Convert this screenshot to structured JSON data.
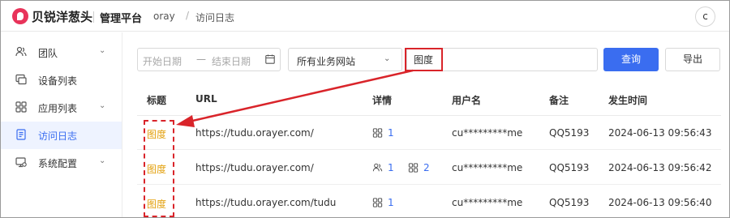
{
  "header": {
    "brand": "贝锐洋葱头",
    "platform": "管理平台",
    "breadcrumb": [
      "oray",
      "访问日志"
    ],
    "avatar_letter": "c"
  },
  "sidebar": {
    "items": [
      {
        "label": "团队",
        "icon": "team-icon",
        "has_caret": true,
        "active": false
      },
      {
        "label": "设备列表",
        "icon": "device-icon",
        "has_caret": false,
        "active": false
      },
      {
        "label": "应用列表",
        "icon": "apps-icon",
        "has_caret": true,
        "active": false
      },
      {
        "label": "访问日志",
        "icon": "log-icon",
        "has_caret": false,
        "active": true
      },
      {
        "label": "系统配置",
        "icon": "settings-icon",
        "has_caret": true,
        "active": false
      }
    ]
  },
  "filters": {
    "start_date_placeholder": "开始日期",
    "dash": "—",
    "end_date_placeholder": "结束日期",
    "site_select": "所有业务网站",
    "search_value": "图度",
    "query_label": "查询",
    "export_label": "导出"
  },
  "table": {
    "headers": {
      "title": "标题",
      "url": "URL",
      "detail": "详情",
      "user": "用户名",
      "note": "备注",
      "time": "发生时间"
    },
    "rows": [
      {
        "title": "图度",
        "url": "https://tudu.orayer.com/",
        "details": [
          {
            "icon": "apps-icon",
            "count": "1"
          }
        ],
        "user": "cu*********me",
        "note": "QQ5193",
        "time": "2024-06-13 09:56:43"
      },
      {
        "title": "图度",
        "url": "https://tudu.orayer.com/",
        "details": [
          {
            "icon": "team-icon",
            "count": "1"
          },
          {
            "icon": "apps-icon",
            "count": "2"
          }
        ],
        "user": "cu*********me",
        "note": "QQ5193",
        "time": "2024-06-13 09:56:42"
      },
      {
        "title": "图度",
        "url": "https://tudu.orayer.com/tudu",
        "details": [
          {
            "icon": "apps-icon",
            "count": "1"
          }
        ],
        "user": "cu*********me",
        "note": "QQ5193",
        "time": "2024-06-13 09:56:40"
      }
    ]
  },
  "colors": {
    "accent": "#3a6df0",
    "title_link": "#e3a10f",
    "annotation": "#d9242a"
  }
}
